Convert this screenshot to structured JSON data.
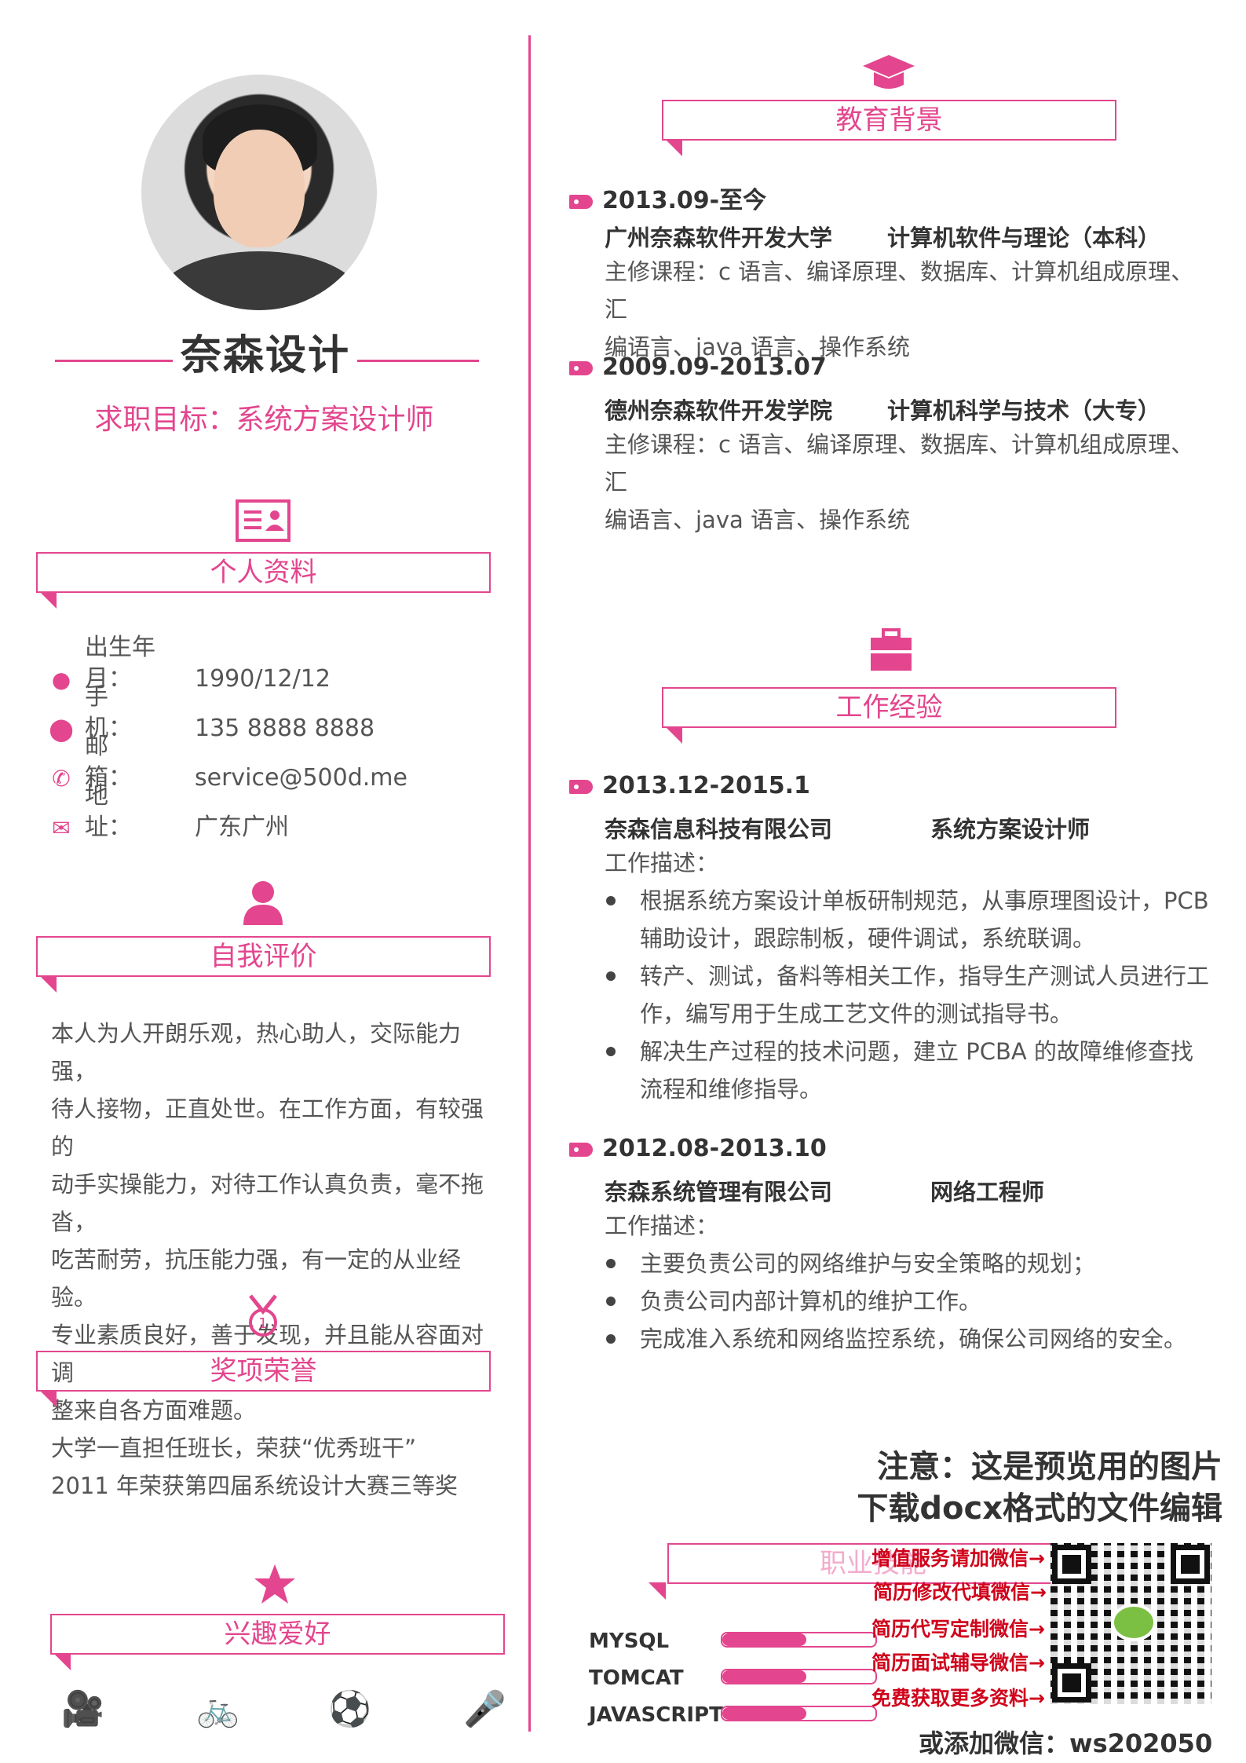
{
  "profile": {
    "name": "奈森设计",
    "goal": "求职目标：系统方案设计师"
  },
  "sections": {
    "personal": "个人资料",
    "self": "自我评价",
    "awards": "奖项荣誉",
    "hobbies": "兴趣爱好",
    "education": "教育背景",
    "work": "工作经验",
    "skills": "职业技能"
  },
  "personal": [
    {
      "label": "出生年月：",
      "value": "1990/12/12",
      "icon": "person-icon"
    },
    {
      "label": "手　　机：",
      "value": "135 8888 8888",
      "icon": "location-icon"
    },
    {
      "label": "邮　　箱：",
      "value": "service@500d.me",
      "icon": "phone-icon"
    },
    {
      "label": "地　　址：",
      "value": "广东广州",
      "icon": "mail-icon"
    }
  ],
  "self_eval": [
    "本人为人开朗乐观，热心助人，交际能力强，",
    "待人接物，正直处世。在工作方面，有较强的",
    "动手实操能力，对待工作认真负责，毫不拖沓，",
    "吃苦耐劳，抗压能力强，有一定的从业经验。",
    "专业素质良好，善于发现，并且能从容面对调",
    "整来自各方面难题。"
  ],
  "awards": [
    "大学一直担任班长，荣获“优秀班干”",
    "2011 年荣获第四届系统设计大赛三等奖"
  ],
  "education": [
    {
      "period": "2013.09-至今",
      "school": "广州奈森软件开发大学",
      "major": "计算机软件与理论（本科）",
      "courses": [
        "主修课程：c 语言、编译原理、数据库、计算机组成原理、汇",
        "编语言、java 语言、操作系统"
      ]
    },
    {
      "period": "2009.09-2013.07",
      "school": "德州奈森软件开发学院",
      "major": "计算机科学与技术（大专）",
      "courses": [
        "主修课程：c 语言、编译原理、数据库、计算机组成原理、汇",
        "编语言、java 语言、操作系统"
      ]
    }
  ],
  "work": [
    {
      "period": "2013.12-2015.1",
      "company": "奈森信息科技有限公司",
      "position": "系统方案设计师",
      "desc_label": "工作描述：",
      "items": [
        "根据系统方案设计单板研制规范，从事原理图设计，PCB 辅助设计，跟踪制板，硬件调试，系统联调。",
        "转产、测试，备料等相关工作，指导生产测试人员进行工作，编写用于生成工艺文件的测试指导书。",
        "解决生产过程的技术问题，建立 PCBA 的故障维修查找流程和维修指导。"
      ]
    },
    {
      "period": "2012.08-2013.10",
      "company": "奈森系统管理有限公司",
      "position": "网络工程师",
      "desc_label": "工作描述：",
      "items": [
        "主要负责公司的网络维护与安全策略的规划；",
        "负责公司内部计算机的维护工作。",
        "完成准入系统和网络监控系统，确保公司网络的安全。"
      ]
    }
  ],
  "skills": [
    {
      "name": "MYSQL",
      "level": 0.55
    },
    {
      "name": "TOMCAT",
      "level": 0.55
    },
    {
      "name": "JAVASCRIPT",
      "level": 0.55
    }
  ],
  "notice": {
    "line1": "注意：这是预览用的图片",
    "line2": "下载docx格式的文件编辑",
    "wechat": [
      "增值服务请加微信→",
      "简历修改代填微信→",
      "简历代写定制微信→",
      "简历面试辅导微信→",
      "免费获取更多资料→"
    ],
    "footer": "或添加微信：ws202050"
  },
  "hobbies": [
    "video-icon",
    "bike-icon",
    "football-icon",
    "mic-icon"
  ],
  "colors": {
    "accent": "#e3468e"
  }
}
